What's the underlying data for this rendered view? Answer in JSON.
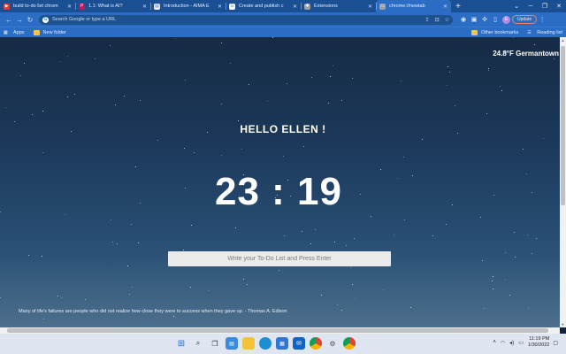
{
  "tabs": [
    {
      "title": "build to-do list chrom",
      "favicon_color": "#e53935",
      "favicon_glyph": "▶",
      "active": false
    },
    {
      "title": "1.1: What is AI?",
      "favicon_color": "#c2185b",
      "favicon_glyph": "P",
      "active": false
    },
    {
      "title": "Introduction - AIMA E",
      "favicon_color": "#eeeeee",
      "favicon_glyph": "▤",
      "active": false
    },
    {
      "title": "Create and publish c",
      "favicon_color": "#ffffff",
      "favicon_glyph": "G",
      "active": false
    },
    {
      "title": "Extensions",
      "favicon_color": "#9aa0a6",
      "favicon_glyph": "✱",
      "active": false
    },
    {
      "title": "chrome://newtab",
      "favicon_color": "#9aa0a6",
      "favicon_glyph": "▭",
      "active": true
    }
  ],
  "omnibox": {
    "placeholder": "Search Google or type a URL"
  },
  "toolbar": {
    "avatar_letter": "E",
    "update_label": "Update"
  },
  "bookmarks": {
    "apps_label": "Apps",
    "new_folder_label": "New folder",
    "other_bookmarks_label": "Other bookmarks",
    "reading_list_label": "Reading list"
  },
  "page": {
    "weather": "24.8°F Germantown",
    "greeting": "HELLO ELLEN !",
    "clock": "23 : 19",
    "todo_placeholder": "Write your To-Do List and Press Enter",
    "quote": "Many of life's failures are people who did not realize how close they were to success when they gave up. - Thomas A. Edison"
  },
  "taskbar": {
    "time": "11:19 PM",
    "date": "1/30/2022"
  }
}
